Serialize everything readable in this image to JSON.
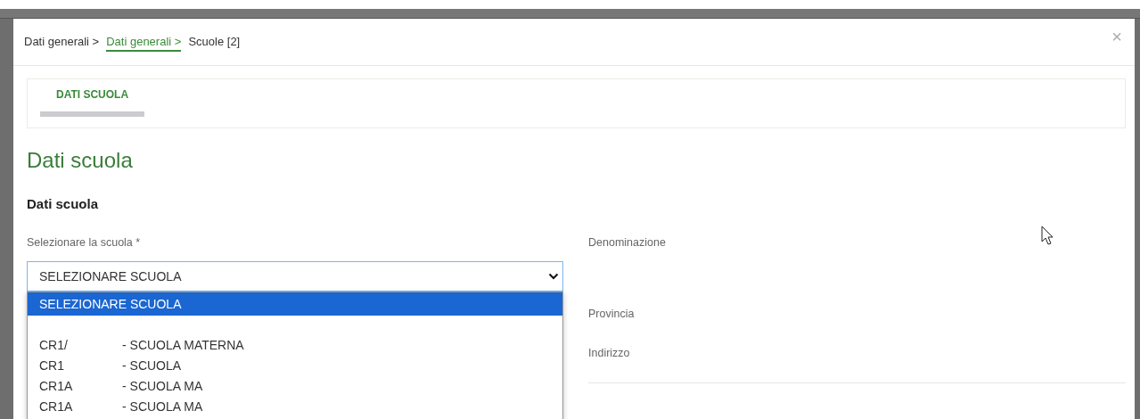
{
  "breadcrumb": [
    {
      "label": "Dati generali >",
      "selected": false
    },
    {
      "label": "Dati generali >",
      "selected": true
    },
    {
      "label": "Scuole [2]",
      "selected": false
    }
  ],
  "close": "×",
  "tabs": [
    {
      "label": "DATI SCUOLA",
      "selected": true
    }
  ],
  "title": "Dati scuola",
  "section_title": "Dati scuola",
  "school_select": {
    "label": "Selezionare la scuola *",
    "value": "SELEZIONARE SCUOLA",
    "expanded": true,
    "options": [
      {
        "kind": "text",
        "label": "SELEZIONARE SCUOLA",
        "selected": true
      },
      {
        "kind": "coded",
        "code": "CR1/",
        "label": "- SCUOLA MATERNA",
        "selected": false
      },
      {
        "kind": "coded",
        "code": "CR1",
        "label": "- SCUOLA",
        "selected": false
      },
      {
        "kind": "coded",
        "code": "CR1A",
        "label": "- SCUOLA MA",
        "selected": false
      },
      {
        "kind": "coded",
        "code": "CR1A",
        "label": "- SCUOLA MA",
        "selected": false
      }
    ]
  },
  "details": [
    {
      "label": "Denominazione"
    },
    {
      "label": "Provincia"
    },
    {
      "label": "Indirizzo"
    }
  ]
}
